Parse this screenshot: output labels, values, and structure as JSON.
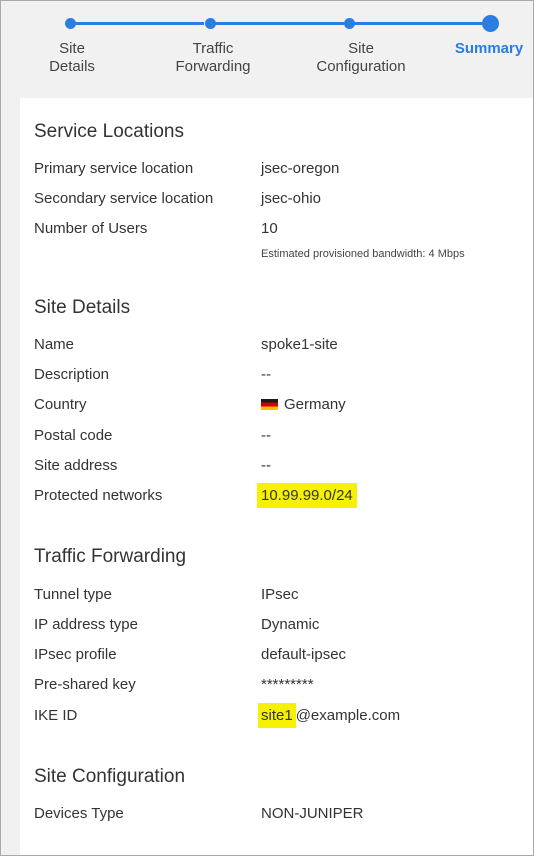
{
  "stepper": {
    "steps": [
      {
        "label_line1": "Site",
        "label_line2": "Details",
        "state": "completed"
      },
      {
        "label_line1": "Traffic",
        "label_line2": "Forwarding",
        "state": "completed"
      },
      {
        "label_line1": "Site",
        "label_line2": "Configuration",
        "state": "completed"
      },
      {
        "label_line1": "Summary",
        "label_line2": "",
        "state": "active"
      }
    ]
  },
  "service_locations": {
    "title": "Service Locations",
    "rows": [
      {
        "label": "Primary service location",
        "value": "jsec-oregon"
      },
      {
        "label": "Secondary service location",
        "value": "jsec-ohio"
      },
      {
        "label": "Number of Users",
        "value": "10"
      }
    ],
    "bandwidth_note": "Estimated provisioned bandwidth:  4 Mbps"
  },
  "site_details": {
    "title": "Site Details",
    "rows": [
      {
        "label": "Name",
        "value": "spoke1-site"
      },
      {
        "label": "Description",
        "value": "--"
      },
      {
        "label": "Country",
        "value": "Germany"
      },
      {
        "label": "Postal code",
        "value": "--"
      },
      {
        "label": "Site address",
        "value": "--"
      },
      {
        "label": "Protected networks",
        "value": "10.99.99.0/24"
      }
    ],
    "country_flag_icon": "germany-flag-icon"
  },
  "traffic_forwarding": {
    "title": "Traffic Forwarding",
    "rows": [
      {
        "label": "Tunnel type",
        "value": "IPsec"
      },
      {
        "label": "IP address type",
        "value": "Dynamic"
      },
      {
        "label": "IPsec profile",
        "value": "default-ipsec"
      },
      {
        "label": "Pre-shared key",
        "value": "*********"
      },
      {
        "label": "IKE ID",
        "value_highlight": "site1",
        "value_rest": "@example.com"
      }
    ]
  },
  "site_configuration": {
    "title": "Site Configuration",
    "rows": [
      {
        "label": "Devices Type",
        "value": "NON-JUNIPER"
      }
    ]
  },
  "colors": {
    "accent": "#2a7de1",
    "highlight": "#f6f100",
    "background": "#f1f1f1"
  }
}
